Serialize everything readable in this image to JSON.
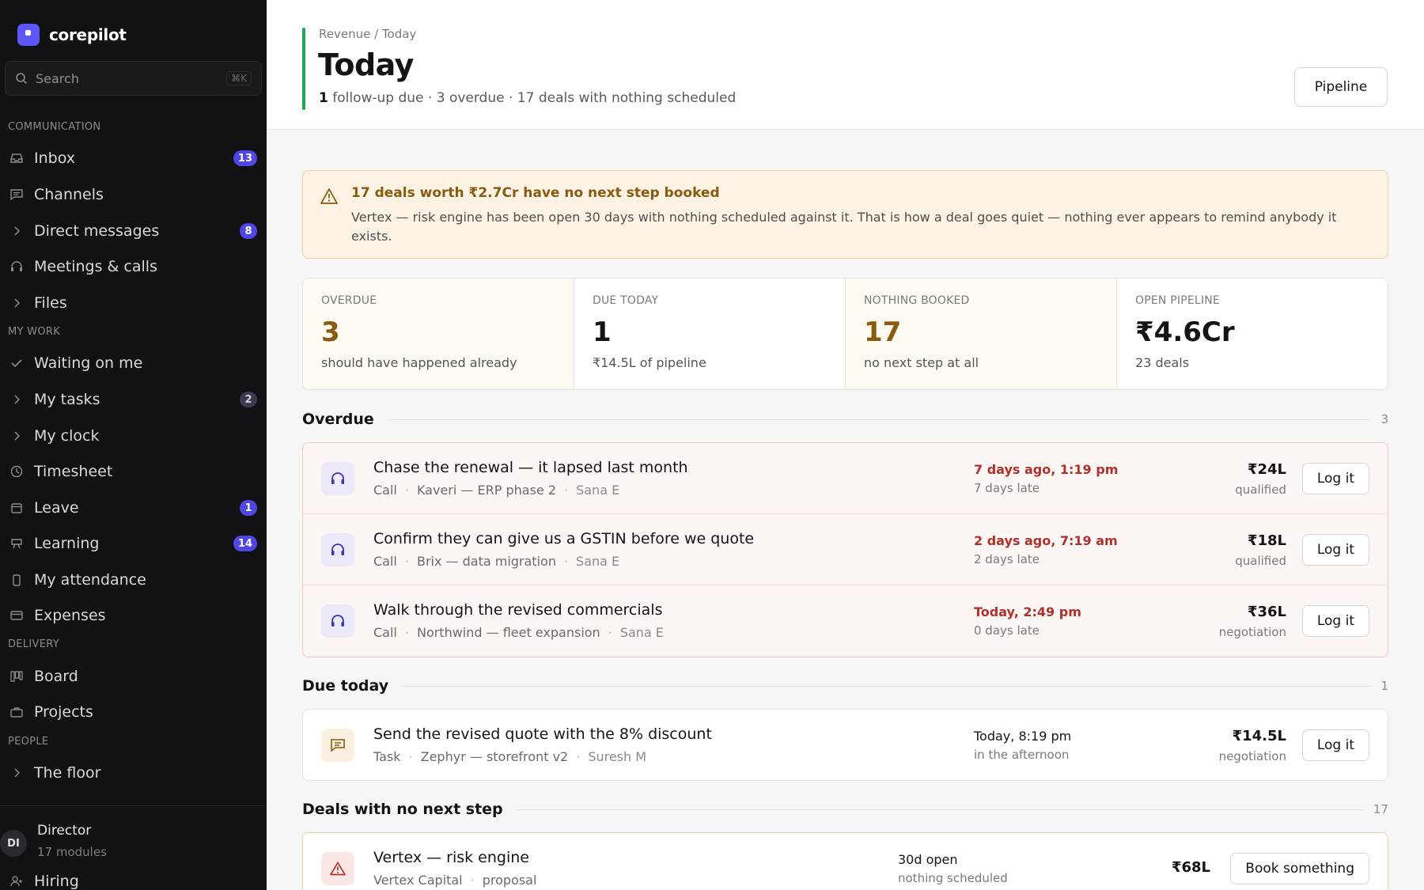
{
  "app": {
    "name": "corepilot"
  },
  "search": {
    "placeholder": "Search",
    "shortcut": "⌘K"
  },
  "sidebar": {
    "sections": {
      "communication": "COMMUNICATION",
      "my_work": "MY WORK",
      "delivery": "DELIVERY",
      "people": "PEOPLE"
    },
    "items": [
      {
        "label": "Inbox",
        "icon": "inbox-icon",
        "badge": "13"
      },
      {
        "label": "Channels",
        "icon": "chat-icon"
      },
      {
        "label": "Direct messages",
        "icon": "chevron-right-icon",
        "badge": "8"
      },
      {
        "label": "Meetings & calls",
        "icon": "headset-icon"
      },
      {
        "label": "Files",
        "icon": "chevron-right-icon"
      },
      {
        "label": "Waiting on me",
        "icon": "check-icon"
      },
      {
        "label": "My tasks",
        "icon": "chevron-right-icon",
        "badge": "2"
      },
      {
        "label": "My clock",
        "icon": "chevron-right-icon"
      },
      {
        "label": "Timesheet",
        "icon": "clock-icon"
      },
      {
        "label": "Leave",
        "icon": "calendar-icon",
        "badge": "1"
      },
      {
        "label": "Learning",
        "icon": "easel-icon",
        "badge": "14"
      },
      {
        "label": "My attendance",
        "icon": "phone-icon"
      },
      {
        "label": "Expenses",
        "icon": "card-icon"
      },
      {
        "label": "Board",
        "icon": "board-icon"
      },
      {
        "label": "Projects",
        "icon": "briefcase-icon"
      },
      {
        "label": "The floor",
        "icon": "chevron-right-icon"
      },
      {
        "label": "Hiring",
        "icon": "user-plus-icon"
      }
    ],
    "user": {
      "initials": "DI",
      "name": "Director",
      "sub": "17 modules"
    }
  },
  "header": {
    "breadcrumb": "Revenue / Today",
    "title": "Today",
    "subtitle_count": "1",
    "subtitle_rest": " follow-up due · 3 overdue · 17 deals with nothing scheduled",
    "pipeline_button": "Pipeline"
  },
  "alert": {
    "title": "17 deals worth ₹2.7Cr have no next step booked",
    "body": "Vertex — risk engine has been open 30 days with nothing scheduled against it. That is how a deal goes quiet — nothing ever appears to remind anybody it exists."
  },
  "stats": [
    {
      "label": "OVERDUE",
      "value": "3",
      "sub": "should have happened already"
    },
    {
      "label": "DUE TODAY",
      "value": "1",
      "sub": "₹14.5L of pipeline"
    },
    {
      "label": "NOTHING BOOKED",
      "value": "17",
      "sub": "no next step at all"
    },
    {
      "label": "OPEN PIPELINE",
      "value": "₹4.6Cr",
      "sub": "23 deals"
    }
  ],
  "overdue": {
    "title": "Overdue",
    "count": "3",
    "rows": [
      {
        "title": "Chase the renewal — it lapsed last month",
        "type": "Call",
        "deal": "Kaveri — ERP phase 2",
        "owner": "Sana E",
        "when": "7 days ago, 1:19 pm",
        "late": "7 days late",
        "amount": "₹24L",
        "stage": "qualified",
        "action": "Log it"
      },
      {
        "title": "Confirm they can give us a GSTIN before we quote",
        "type": "Call",
        "deal": "Brix — data migration",
        "owner": "Sana E",
        "when": "2 days ago, 7:19 am",
        "late": "2 days late",
        "amount": "₹18L",
        "stage": "qualified",
        "action": "Log it"
      },
      {
        "title": "Walk through the revised commercials",
        "type": "Call",
        "deal": "Northwind — fleet expansion",
        "owner": "Sana E",
        "when": "Today, 2:49 pm",
        "late": "0 days late",
        "amount": "₹36L",
        "stage": "negotiation",
        "action": "Log it"
      }
    ]
  },
  "due_today": {
    "title": "Due today",
    "count": "1",
    "rows": [
      {
        "title": "Send the revised quote with the 8% discount",
        "type": "Task",
        "deal": "Zephyr — storefront v2",
        "owner": "Suresh M",
        "when": "Today, 8:19 pm",
        "late": "in the afternoon",
        "amount": "₹14.5L",
        "stage": "negotiation",
        "action": "Log it"
      }
    ]
  },
  "no_next_step": {
    "title": "Deals with no next step",
    "count": "17",
    "rows": [
      {
        "title": "Vertex — risk engine",
        "company": "Vertex Capital",
        "stage": "proposal",
        "open": "30d open",
        "status": "nothing scheduled",
        "amount": "₹68L",
        "action": "Book something"
      }
    ]
  }
}
